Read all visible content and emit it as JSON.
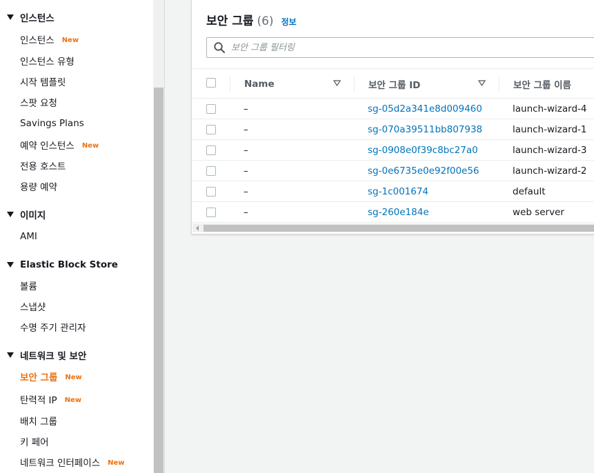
{
  "sidebar": {
    "sections": [
      {
        "label": "인스턴스",
        "items": [
          {
            "label": "인스턴스",
            "badge": "New"
          },
          {
            "label": "인스턴스 유형"
          },
          {
            "label": "시작 템플릿"
          },
          {
            "label": "스팟 요청"
          },
          {
            "label": "Savings Plans"
          },
          {
            "label": "예약 인스턴스",
            "badge": "New"
          },
          {
            "label": "전용 호스트"
          },
          {
            "label": "용량 예약"
          }
        ]
      },
      {
        "label": "이미지",
        "items": [
          {
            "label": "AMI"
          }
        ]
      },
      {
        "label": "Elastic Block Store",
        "items": [
          {
            "label": "볼륨"
          },
          {
            "label": "스냅샷"
          },
          {
            "label": "수명 주기 관리자"
          }
        ]
      },
      {
        "label": "네트워크 및 보안",
        "items": [
          {
            "label": "보안 그룹",
            "badge": "New",
            "active": true
          },
          {
            "label": "탄력적 IP",
            "badge": "New"
          },
          {
            "label": "배치 그룹"
          },
          {
            "label": "키 페어"
          },
          {
            "label": "네트워크 인터페이스",
            "badge": "New"
          }
        ]
      }
    ],
    "accent_color": "#ec7211"
  },
  "panel": {
    "title": "보안 그룹",
    "count": "(6)",
    "info_label": "정보",
    "filter_placeholder": "보안 그룹 필터링"
  },
  "table": {
    "columns": [
      "Name",
      "보안 그룹 ID",
      "보안 그룹 이름"
    ],
    "rows": [
      {
        "name": "–",
        "id": "sg-05d2a341e8d009460",
        "group_name": "launch-wizard-4"
      },
      {
        "name": "–",
        "id": "sg-070a39511bb807938",
        "group_name": "launch-wizard-1"
      },
      {
        "name": "–",
        "id": "sg-0908e0f39c8bc27a0",
        "group_name": "launch-wizard-3"
      },
      {
        "name": "–",
        "id": "sg-0e6735e0e92f00e56",
        "group_name": "launch-wizard-2"
      },
      {
        "name": "–",
        "id": "sg-1c001674",
        "group_name": "default"
      },
      {
        "name": "–",
        "id": "sg-260e184e",
        "group_name": "web server"
      }
    ],
    "link_color": "#0073bb"
  }
}
